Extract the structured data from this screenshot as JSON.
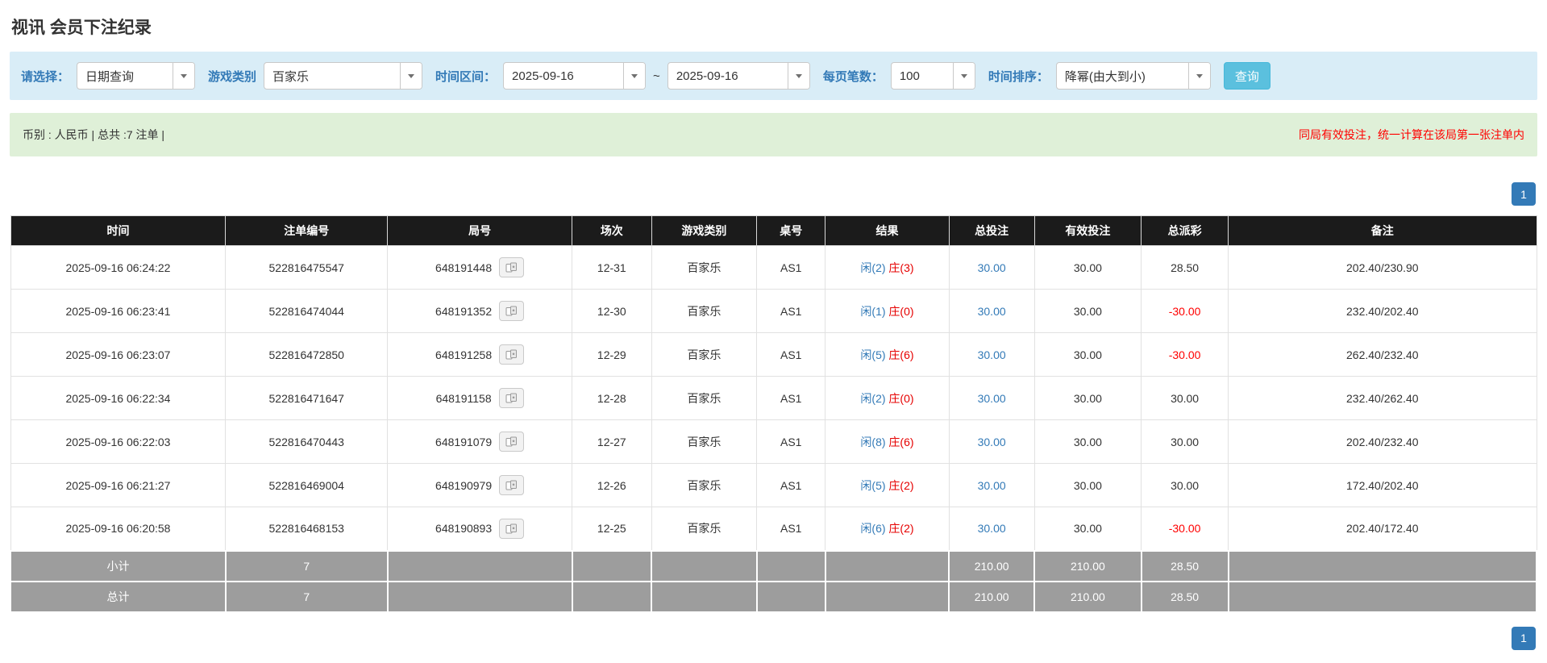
{
  "page_title": "视讯 会员下注纪录",
  "filters": {
    "query_type": {
      "label": "请选择：",
      "value": "日期查询"
    },
    "game_type": {
      "label": "游戏类别",
      "value": "百家乐"
    },
    "time_range": {
      "label": "时间区间：",
      "from": "2025-09-16",
      "separator": "~",
      "to": "2025-09-16"
    },
    "page_size": {
      "label": "每页笔数：",
      "value": "100"
    },
    "sort": {
      "label": "时间排序：",
      "value": "降幂(由大到小)"
    },
    "search_button": "查询"
  },
  "summary": {
    "left": "币别 : 人民币 | 总共 :7 注单 |",
    "right": "同局有效投注，统一计算在该局第一张注单内"
  },
  "pagination": {
    "page": "1"
  },
  "colors": {
    "accent_blue": "#337ab7",
    "search_button": "#5bc0de",
    "filter_bg": "#d9edf7",
    "summary_bg": "#dff0d8",
    "header_bg": "#1b1b1b",
    "footer_bg": "#9d9d9d",
    "negative_red": "#ff0000"
  },
  "table": {
    "headers": [
      "时间",
      "注单编号",
      "局号",
      "场次",
      "游戏类别",
      "桌号",
      "结果",
      "总投注",
      "有效投注",
      "总派彩",
      "备注"
    ],
    "col_widths": [
      "14.1%",
      "10.6%",
      "12.1%",
      "5.2%",
      "6.9%",
      "4.5%",
      "8.1%",
      "5.6%",
      "7.0%",
      "5.7%",
      "20.2%"
    ],
    "rows": [
      {
        "time": "2025-09-16 06:24:22",
        "bet_id": "522816475547",
        "round_id": "648191448",
        "session": "12-31",
        "game": "百家乐",
        "table_no": "AS1",
        "player": "闲(2)",
        "banker": "庄(3)",
        "total_bet": "30.00",
        "valid_bet": "30.00",
        "payout": "28.50",
        "remark": "202.40/230.90"
      },
      {
        "time": "2025-09-16 06:23:41",
        "bet_id": "522816474044",
        "round_id": "648191352",
        "session": "12-30",
        "game": "百家乐",
        "table_no": "AS1",
        "player": "闲(1)",
        "banker": "庄(0)",
        "total_bet": "30.00",
        "valid_bet": "30.00",
        "payout": "-30.00",
        "remark": "232.40/202.40"
      },
      {
        "time": "2025-09-16 06:23:07",
        "bet_id": "522816472850",
        "round_id": "648191258",
        "session": "12-29",
        "game": "百家乐",
        "table_no": "AS1",
        "player": "闲(5)",
        "banker": "庄(6)",
        "total_bet": "30.00",
        "valid_bet": "30.00",
        "payout": "-30.00",
        "remark": "262.40/232.40"
      },
      {
        "time": "2025-09-16 06:22:34",
        "bet_id": "522816471647",
        "round_id": "648191158",
        "session": "12-28",
        "game": "百家乐",
        "table_no": "AS1",
        "player": "闲(2)",
        "banker": "庄(0)",
        "total_bet": "30.00",
        "valid_bet": "30.00",
        "payout": "30.00",
        "remark": "232.40/262.40"
      },
      {
        "time": "2025-09-16 06:22:03",
        "bet_id": "522816470443",
        "round_id": "648191079",
        "session": "12-27",
        "game": "百家乐",
        "table_no": "AS1",
        "player": "闲(8)",
        "banker": "庄(6)",
        "total_bet": "30.00",
        "valid_bet": "30.00",
        "payout": "30.00",
        "remark": "202.40/232.40"
      },
      {
        "time": "2025-09-16 06:21:27",
        "bet_id": "522816469004",
        "round_id": "648190979",
        "session": "12-26",
        "game": "百家乐",
        "table_no": "AS1",
        "player": "闲(5)",
        "banker": "庄(2)",
        "total_bet": "30.00",
        "valid_bet": "30.00",
        "payout": "30.00",
        "remark": "172.40/202.40"
      },
      {
        "time": "2025-09-16 06:20:58",
        "bet_id": "522816468153",
        "round_id": "648190893",
        "session": "12-25",
        "game": "百家乐",
        "table_no": "AS1",
        "player": "闲(6)",
        "banker": "庄(2)",
        "total_bet": "30.00",
        "valid_bet": "30.00",
        "payout": "-30.00",
        "remark": "202.40/172.40"
      }
    ],
    "footer": [
      {
        "label": "小计",
        "count": "7",
        "total_bet": "210.00",
        "valid_bet": "210.00",
        "payout": "28.50"
      },
      {
        "label": "总计",
        "count": "7",
        "total_bet": "210.00",
        "valid_bet": "210.00",
        "payout": "28.50"
      }
    ]
  }
}
